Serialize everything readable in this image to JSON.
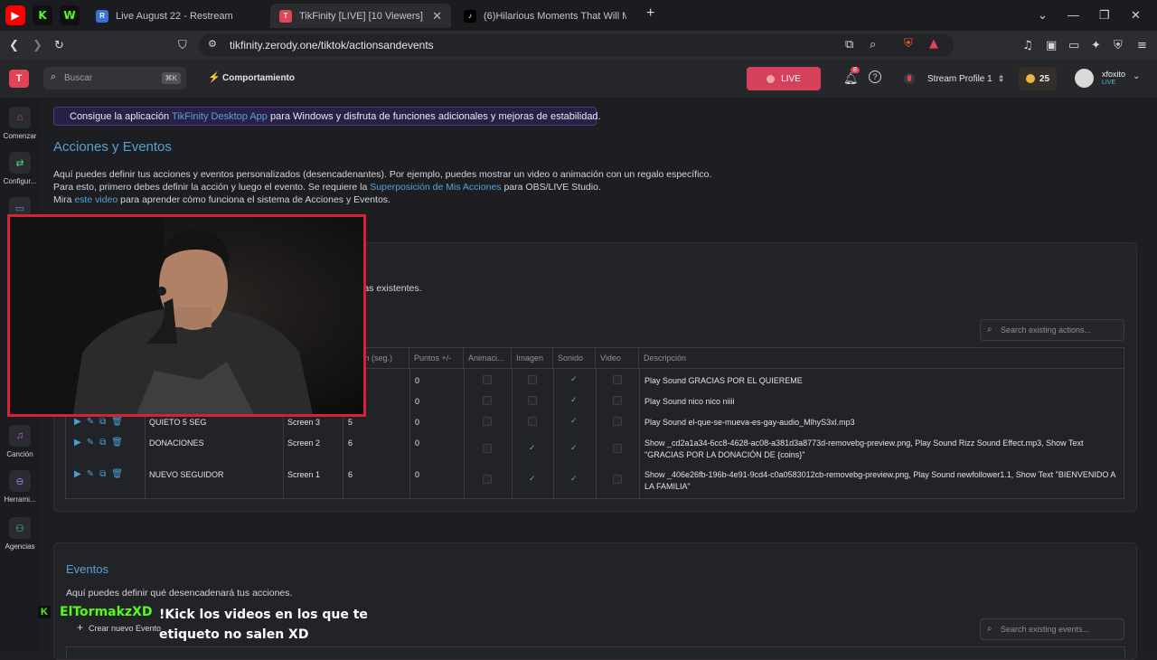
{
  "browser": {
    "tabs": [
      {
        "label": "Live August 22 - Restream",
        "fav": "R",
        "fav_color": "#3b6fdc"
      },
      {
        "label": "TikFinity [LIVE] [10 Viewers]",
        "fav": "T",
        "fav_color": "#e34257"
      },
      {
        "label": "(6)Hilarious Moments That Will M",
        "fav": "♪",
        "fav_color": "#000000"
      }
    ],
    "pinned_tabs": [
      {
        "name": "youtube-pinned",
        "glyph": "▶",
        "color": "#ff0000"
      },
      {
        "name": "kick-pinned",
        "glyph": "K",
        "color": "#53fc18"
      },
      {
        "name": "w-pinned",
        "glyph": "W",
        "color": "#53fc18"
      }
    ],
    "url": "tikfinity.zerody.one/tiktok/actionsandevents",
    "new_tab": "+",
    "brave_badge": "56"
  },
  "header": {
    "search_placeholder": "Buscar",
    "search_shortcut": "⌘K",
    "behavior_label": "Comportamiento",
    "live_label": "LIVE",
    "notif_count": "8",
    "stream_profile": "Stream Profile 1",
    "coins": "25",
    "username": "xfoxito",
    "user_status": "LIVE"
  },
  "sidebar": {
    "items": [
      {
        "label": "Comenzar",
        "icon": "home-icon"
      },
      {
        "label": "Configur...",
        "icon": "sliders-icon"
      },
      {
        "label": "Canción",
        "icon": "music-icon"
      },
      {
        "label": "Herrami...",
        "icon": "gamepad-icon"
      },
      {
        "label": "Agencias",
        "icon": "agency-icon"
      }
    ]
  },
  "banner": {
    "pre": "Consigue la aplicación ",
    "link": "TikFinity Desktop App",
    "post": " para Windows y disfruta de funciones adicionales y mejoras de estabilidad."
  },
  "page": {
    "title": "Acciones y Eventos",
    "line1": "Aquí puedes definir tus acciones y eventos personalizados (desencadenantes). Por ejemplo, puedes mostrar un video o animación con un regalo específico.",
    "line2_pre": "Para esto, primero debes definir la acción y luego el evento. Se requiere la ",
    "line2_link": "Superposición de Mis Acciones",
    "line2_post": " para OBS/LIVE Studio.",
    "line3_pre": "Mira ",
    "line3_link": "este video",
    "line3_post": " para aprender cómo funciona el sistema de Acciones y Eventos."
  },
  "actions": {
    "subtitle_fragment": "las existentes.",
    "search_placeholder": "Search existing actions...",
    "columns": [
      "ración (seg.)",
      "Puntos +/-",
      "Animaci...",
      "Imagen",
      "Sonido",
      "Video",
      "Descripción"
    ],
    "rows": [
      {
        "name": "",
        "screen": "",
        "duration": "",
        "points": "0",
        "image": false,
        "sound": true,
        "desc": "Play Sound GRACIAS POR EL QUIEREME"
      },
      {
        "name": "",
        "screen": "",
        "duration": "",
        "points": "0",
        "image": false,
        "sound": true,
        "desc": "Play Sound nico nico niiii"
      },
      {
        "name": "QUIETO 5 SEG",
        "screen": "Screen 3",
        "duration": "5",
        "points": "0",
        "image": false,
        "sound": true,
        "desc": "Play Sound el-que-se-mueva-es-gay-audio_MlhyS3xl.mp3"
      },
      {
        "name": "DONACIONES",
        "screen": "Screen 2",
        "duration": "6",
        "points": "0",
        "image": true,
        "sound": true,
        "desc": "Show _cd2a1a34-6cc8-4628-ac08-a381d3a8773d-removebg-preview.png, Play Sound Rizz Sound Effect.mp3, Show Text \"GRACIAS POR LA DONACIÓN DE {coins}\""
      },
      {
        "name": "NUEVO SEGUIDOR",
        "screen": "Screen 1",
        "duration": "6",
        "points": "0",
        "image": true,
        "sound": true,
        "desc": "Show _406e26fb-196b-4e91-9cd4-c0a0583012cb-removebg-preview.png, Play Sound newfollower1.1, Show Text \"BIENVENIDO A LA FAMILIA\""
      }
    ]
  },
  "events": {
    "title": "Eventos",
    "subtitle": "Aquí puedes definir qué desencadenará tus acciones.",
    "create_label": "Crear nuevo Evento",
    "search_placeholder": "Search existing events..."
  },
  "chat_overlay": {
    "badge": "K",
    "user": "ElTormakzXD",
    "message": "!Kick los videos en los que te etiqueto no salen XD"
  }
}
